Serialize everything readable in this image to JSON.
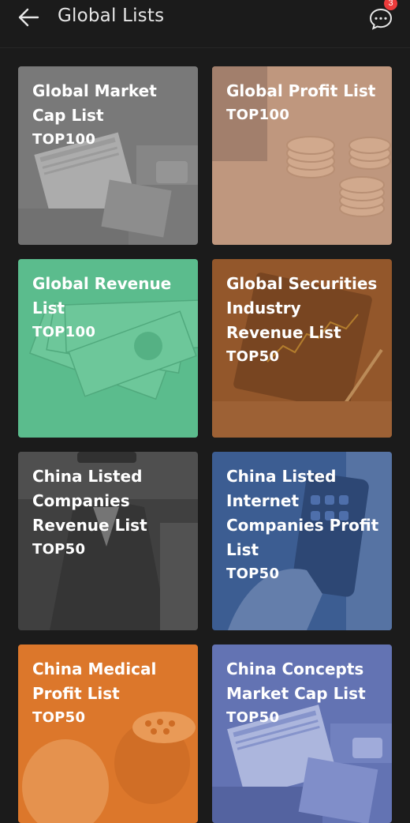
{
  "header": {
    "title": "Global Lists",
    "badge_count": "3",
    "back_icon": "arrow-left-icon",
    "message_icon": "chat-bubble-icon"
  },
  "cards": [
    {
      "title": "Global Market Cap List",
      "tag": "TOP100",
      "overlay": "#8f8f8f",
      "bg_theme": "newspaper"
    },
    {
      "title": "Global Profit List",
      "tag": "TOP100",
      "overlay": "#c99f86",
      "bg_theme": "coins"
    },
    {
      "title": "Global Revenue List",
      "tag": "TOP100",
      "overlay": "#5fc08f",
      "bg_theme": "banknotes"
    },
    {
      "title": "Global Securities Industry Revenue List",
      "tag": "TOP50",
      "overlay": "#9a5a2f",
      "bg_theme": "stock-chart"
    },
    {
      "title": "China Listed Companies Revenue List",
      "tag": "TOP50",
      "overlay": "#4a4a4a",
      "bg_theme": "businessman"
    },
    {
      "title": "China Listed Internet Companies Profit List",
      "tag": "TOP50",
      "overlay": "#3e5f95",
      "bg_theme": "smartphone"
    },
    {
      "title": "China Medical Profit List",
      "tag": "TOP50",
      "overlay": "#df7c2c",
      "bg_theme": "surgeons"
    },
    {
      "title": "China Concepts Market Cap List",
      "tag": "TOP50",
      "overlay": "#6f7fc0",
      "bg_theme": "newspaper"
    }
  ]
}
